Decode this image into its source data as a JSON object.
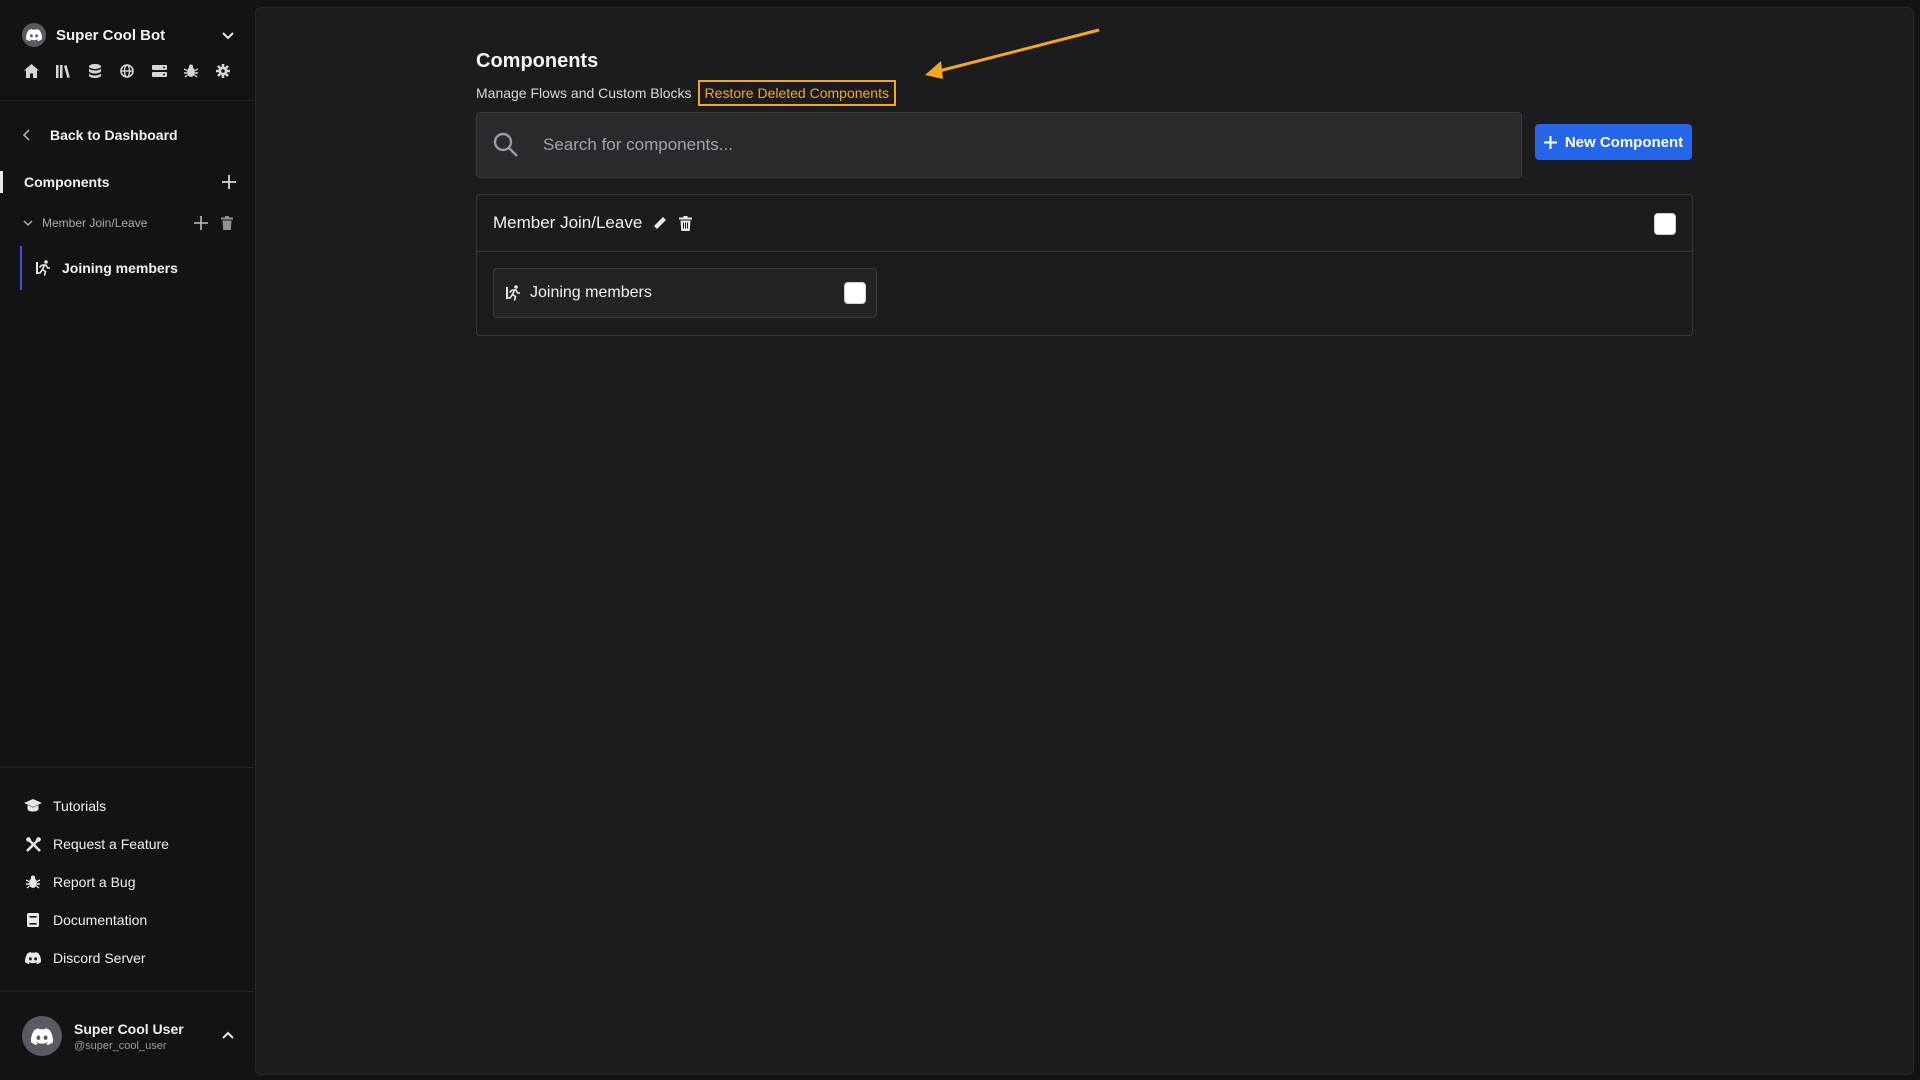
{
  "sidebar": {
    "bot_name": "Super Cool Bot",
    "nav_icons": [
      "home-icon",
      "library-icon",
      "database-icon",
      "globe-icon",
      "server-icon",
      "bug-icon",
      "gear-icon"
    ],
    "back_label": "Back to Dashboard",
    "components_label": "Components",
    "group_label": "Member Join/Leave",
    "sub_item_label": "Joining members",
    "footer_links": [
      {
        "label": "Tutorials",
        "icon": "graduation-cap-icon"
      },
      {
        "label": "Request a Feature",
        "icon": "tools-icon"
      },
      {
        "label": "Report a Bug",
        "icon": "bug-icon"
      },
      {
        "label": "Documentation",
        "icon": "book-icon"
      },
      {
        "label": "Discord Server",
        "icon": "discord-icon"
      }
    ],
    "user": {
      "name": "Super Cool User",
      "handle": "@super_cool_user"
    }
  },
  "main": {
    "title": "Components",
    "subtitle": "Manage Flows and Custom Blocks",
    "restore_label": "Restore Deleted Components",
    "search_placeholder": "Search for components...",
    "new_button_label": "New Component",
    "group": {
      "title": "Member Join/Leave",
      "items": [
        {
          "label": "Joining members"
        }
      ]
    }
  },
  "colors": {
    "accent": "#2565e8",
    "highlight": "#f5a623",
    "active_bar": "#4b50d6"
  }
}
